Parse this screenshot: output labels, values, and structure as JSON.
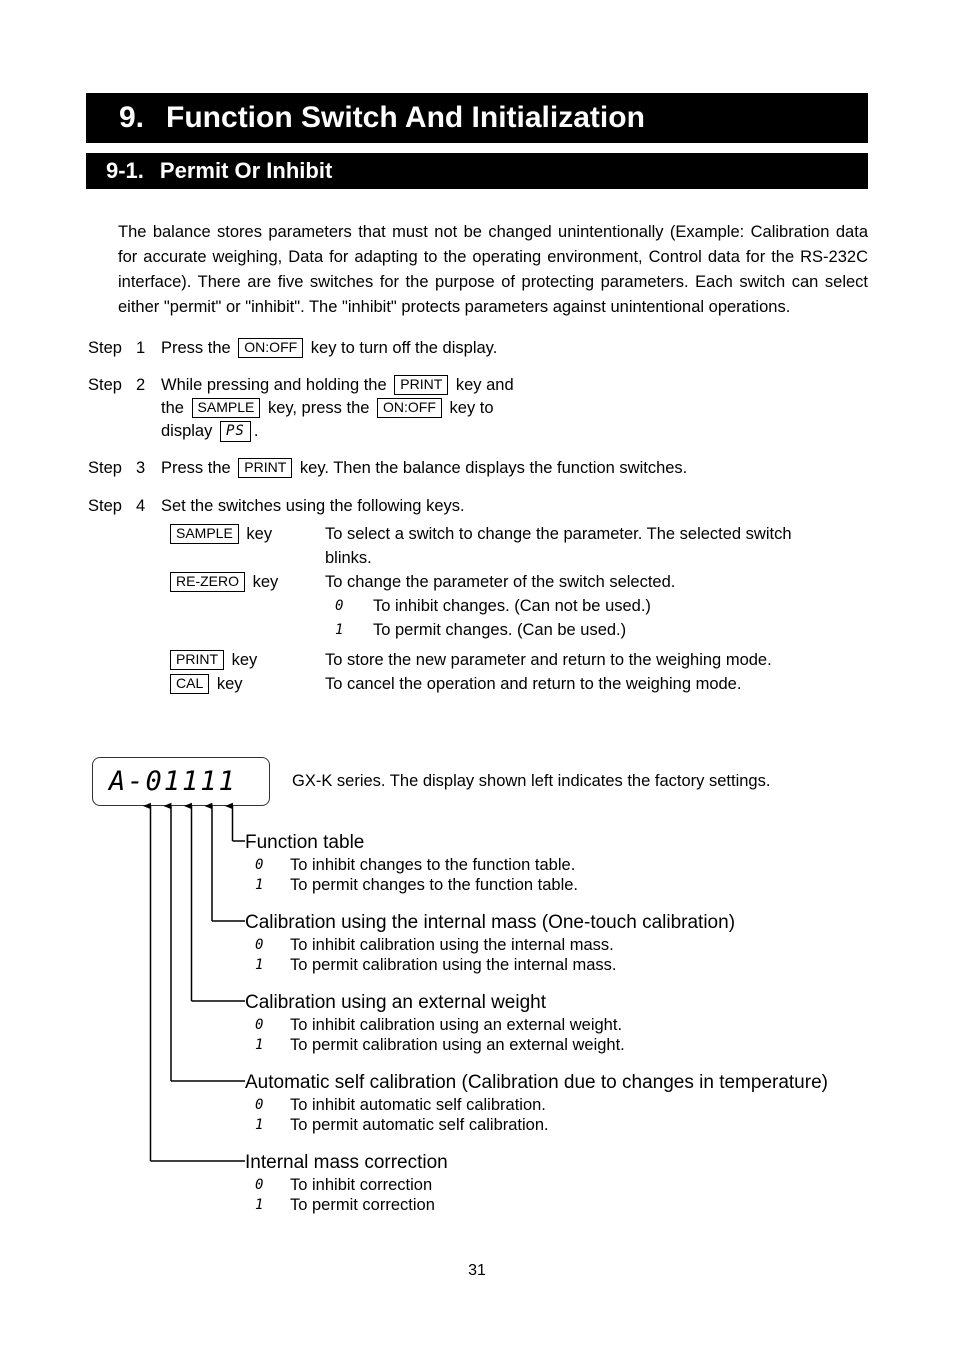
{
  "chapter": {
    "number": "9.",
    "title": "Function Switch And Initialization"
  },
  "section": {
    "number": "9-1.",
    "title": "Permit Or Inhibit"
  },
  "intro": "The balance stores parameters that must not be changed unintentionally (Example: Calibration data for accurate weighing, Data for adapting to the operating environment, Control data for the RS-232C interface). There are five switches for the purpose of protecting parameters. Each switch can select either \"permit\" or \"inhibit\". The \"inhibit\" protects parameters against unintentional operations.",
  "steps": {
    "label": "Step",
    "step1": {
      "index": "1",
      "text_a": "Press the",
      "key1": "ON:OFF",
      "text_b": "key to turn off the display."
    },
    "step2": {
      "index": "2",
      "text_a": "While pressing and holding the",
      "key1": "PRINT",
      "text_b": "key and",
      "text_c": "the",
      "key2": "SAMPLE",
      "text_d": "key, press the",
      "key3": "ON:OFF",
      "text_e": "key to",
      "text_f": "display",
      "lcd": "PS",
      "text_g": "."
    },
    "step3": {
      "index": "3",
      "text_a": "Press the",
      "key1": "PRINT",
      "text_b": "key. Then the balance displays the function switches."
    },
    "step4": {
      "index": "4",
      "text_a": "Set the switches using the following keys."
    }
  },
  "key_rows": [
    {
      "key": "SAMPLE",
      "key_suffix": "key",
      "desc": "To select a switch to change the parameter. The selected switch",
      "desc2": "blinks."
    },
    {
      "key": "RE-ZERO",
      "key_suffix": "key",
      "desc": "To change the parameter of the switch selected."
    },
    {
      "key": "PRINT",
      "key_suffix": "key",
      "desc": "To store the new parameter and return to the weighing mode."
    },
    {
      "key": "CAL",
      "key_suffix": "key",
      "desc": "To cancel the operation and return to the weighing mode."
    }
  ],
  "rezero_options": [
    {
      "mark": "0",
      "text": "To inhibit changes. (Can not be used.)"
    },
    {
      "mark": "1",
      "text": "To permit changes. (Can be used.)"
    }
  ],
  "display": {
    "value": "A-01111",
    "caption": "GX-K series. The display shown left indicates the factory settings."
  },
  "annotations": [
    {
      "heading": "Function table",
      "options": [
        {
          "mark": "0",
          "text": "To inhibit changes to the function table."
        },
        {
          "mark": "1",
          "text": "To permit changes to the function table."
        }
      ]
    },
    {
      "heading": "Calibration using the internal mass (One-touch calibration)",
      "options": [
        {
          "mark": "0",
          "text": "To inhibit calibration using the internal mass."
        },
        {
          "mark": "1",
          "text": "To permit calibration using the internal mass."
        }
      ]
    },
    {
      "heading": "Calibration using an external weight",
      "options": [
        {
          "mark": "0",
          "text": "To inhibit calibration using an external weight."
        },
        {
          "mark": "1",
          "text": "To permit calibration using an external weight."
        }
      ]
    },
    {
      "heading": "Automatic self calibration (Calibration due to changes in temperature)",
      "options": [
        {
          "mark": "0",
          "text": "To inhibit automatic self calibration."
        },
        {
          "mark": "1",
          "text": "To permit automatic self calibration."
        }
      ]
    },
    {
      "heading": "Internal mass correction",
      "options": [
        {
          "mark": "0",
          "text": "To inhibit correction"
        },
        {
          "mark": "1",
          "text": "To permit correction"
        }
      ]
    }
  ],
  "page_number": "31"
}
